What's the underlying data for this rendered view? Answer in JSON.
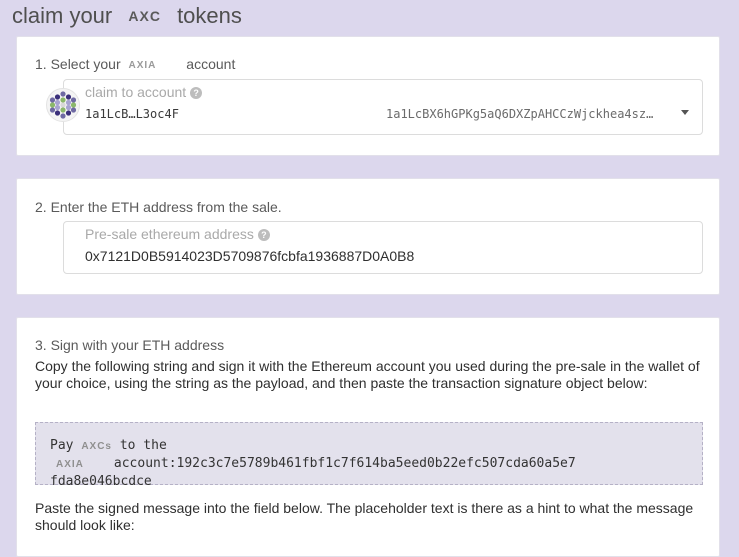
{
  "header": {
    "title_prefix": "claim your",
    "token_symbol": "AXC",
    "title_suffix": "tokens"
  },
  "step1": {
    "label_prefix": "1. Select your",
    "chain": "AXIA",
    "label_suffix": "account",
    "field_label": "claim to account",
    "account_short": "1a1LcB…L3oc4F",
    "account_full": "1a1LcBX6hGPKg5aQ6DXZpAHCCzWjckhea4sz…",
    "avatar_icon": "polkadot-identicon",
    "dropdown_icon": "caret-down-icon"
  },
  "step2": {
    "label": "2. Enter the ETH address from the sale.",
    "field_label": "Pre-sale ethereum address",
    "value": "0x7121D0B5914023D5709876fcbfa1936887D0A0B8"
  },
  "step3": {
    "label": "3. Sign with your ETH address",
    "instructions": "Copy the following string and sign it with the Ethereum account you used during the pre-sale in the wallet of your choice, using the string as the payload, and then paste the transaction signature object below:",
    "payload": {
      "pay": "Pay",
      "token": "AXCs",
      "to_the": "to the",
      "chain": "AXIA",
      "account": "account:192c3c7e5789b461fbf1c7f614ba5eed0b22efc507cda60a5e7",
      "account_cont": "fda8e046bcdce"
    },
    "paste_hint": "Paste the signed message into the field below. The placeholder text is there as a hint to what the message should look like:"
  },
  "colors": {
    "background": "#dcd7ed",
    "card": "#ffffff",
    "payload_bg": "#e3e1ec"
  }
}
